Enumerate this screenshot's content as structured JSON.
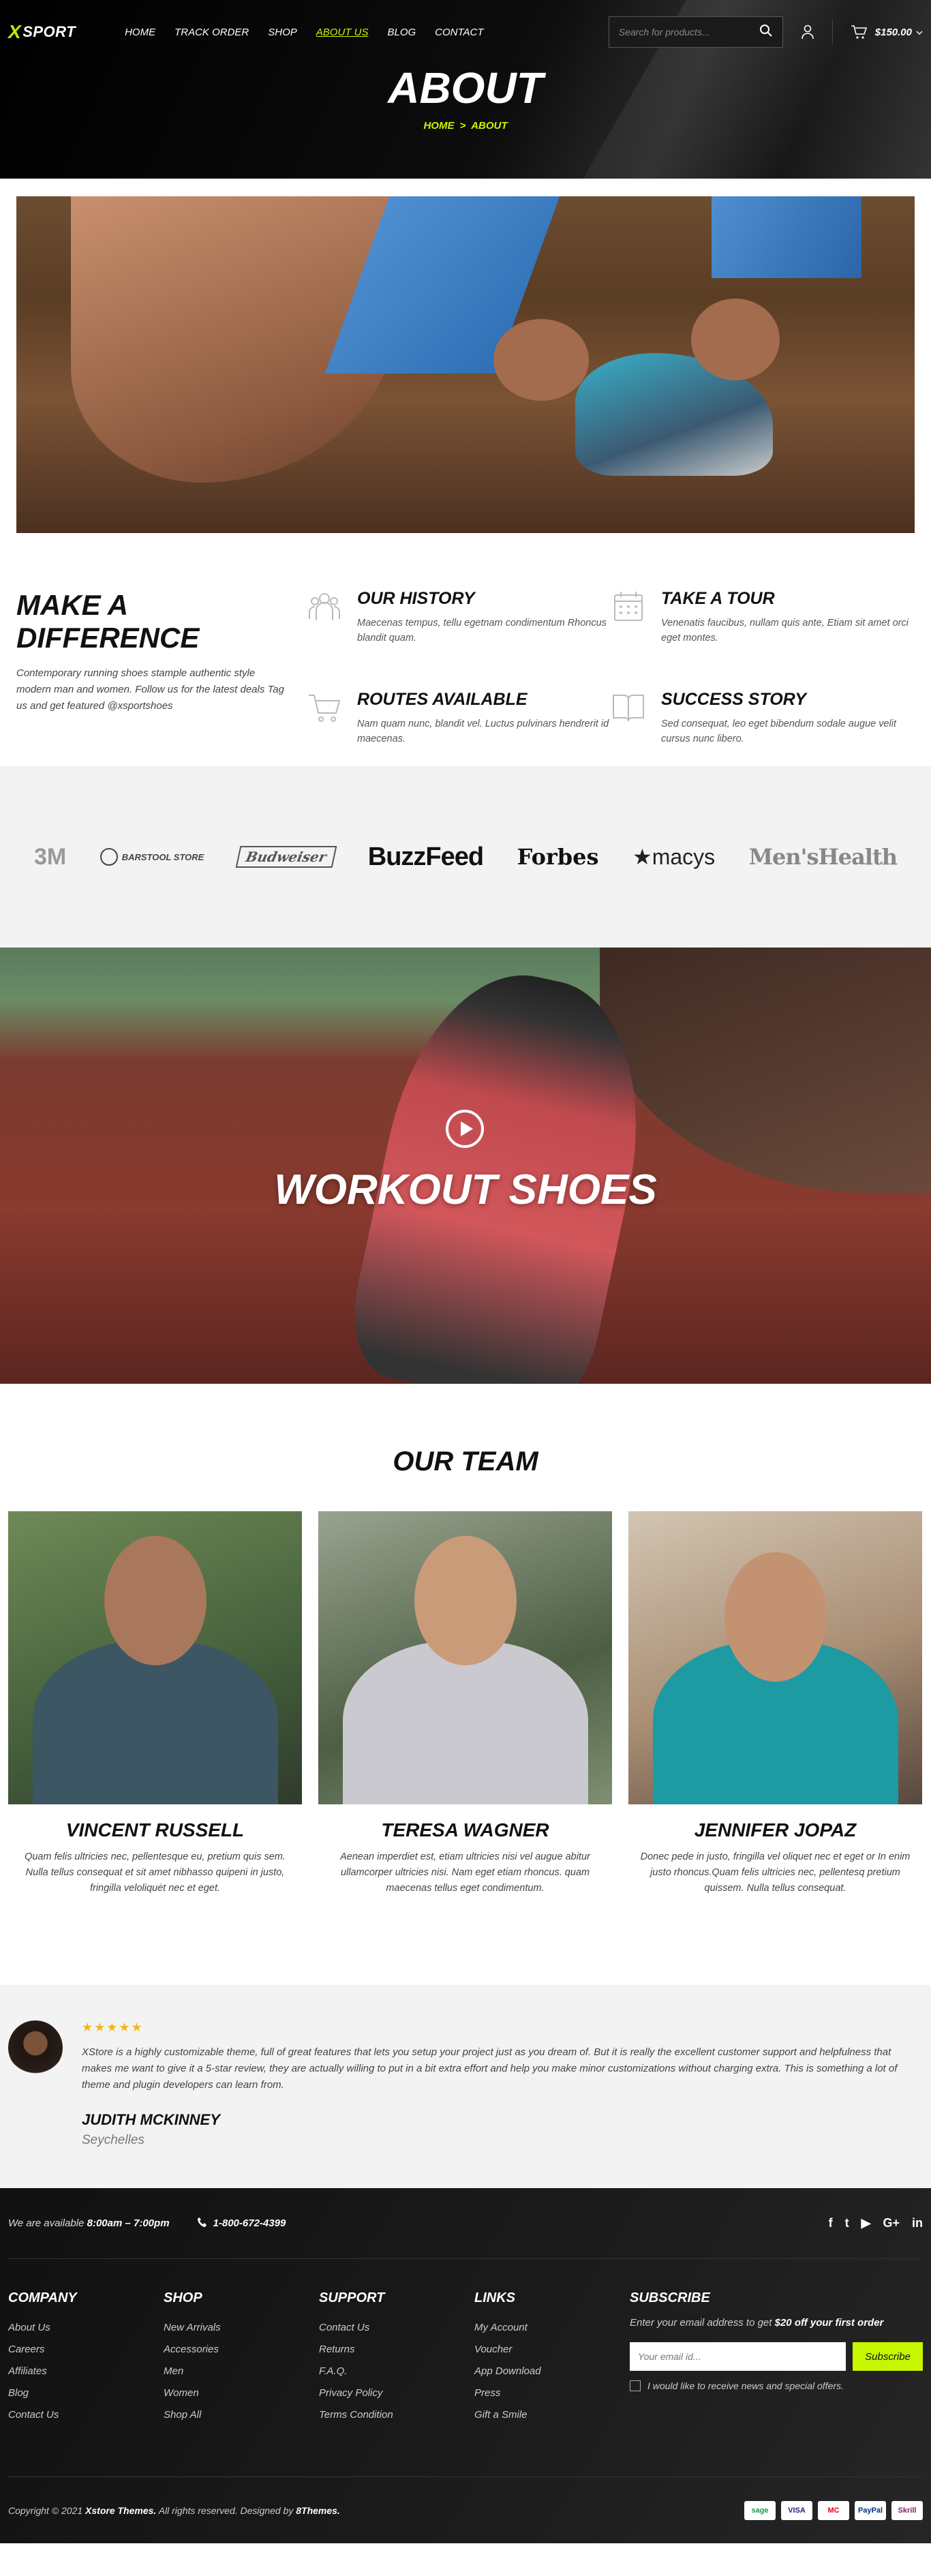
{
  "header": {
    "logo_text": "SPORT",
    "logo_mark": "X",
    "nav": [
      "HOME",
      "TRACK ORDER",
      "SHOP",
      "ABOUT US",
      "BLOG",
      "CONTACT"
    ],
    "search_placeholder": "Search for products...",
    "cart_total": "$150.00"
  },
  "hero": {
    "title": "ABOUT",
    "breadcrumb_home": "HOME",
    "breadcrumb_sep": ">",
    "breadcrumb_current": "ABOUT"
  },
  "intro": {
    "title": "MAKE A DIFFERENCE",
    "text": "Contemporary running shoes stample authentic style modern man and women. Follow us for the latest deals Tag us and get featured @xsportshoes"
  },
  "features": [
    {
      "title": "OUR HISTORY",
      "text": "Maecenas tempus, tellu egetnam condimentum Rhoncus blandit quam.",
      "icon": "people-icon"
    },
    {
      "title": "TAKE A TOUR",
      "text": "Venenatis faucibus, nullam quis ante, Etiam sit amet orci eget montes.",
      "icon": "calendar-icon"
    },
    {
      "title": "ROUTES AVAILABLE",
      "text": "Nam quam nunc, blandit vel. Luctus pulvinars hendrerit id maecenas.",
      "icon": "cart-icon"
    },
    {
      "title": "SUCCESS STORY",
      "text": "Sed consequat, leo eget bibendum sodale augue velit cursus nunc libero.",
      "icon": "book-icon"
    }
  ],
  "brands": [
    "3M",
    "BARSTOOL STORE",
    "Budweiser",
    "BuzzFeed",
    "Forbes",
    "★macys",
    "Men'sHealth"
  ],
  "video": {
    "title": "WORKOUT SHOES"
  },
  "team": {
    "title": "OUR TEAM",
    "members": [
      {
        "name": "VINCENT RUSSELL",
        "bio": "Quam felis ultricies nec, pellentesque eu, pretium quis sem. Nulla tellus consequat et sit amet nibhasso quipeni in justo, fringilla veloliquėt nec et eget."
      },
      {
        "name": "TERESA WAGNER",
        "bio": "Aenean imperdiet est, etiam ultricies nisi vel augue abitur ullamcorper ultricies nisi. Nam eget etiam rhoncus. quam maecenas tellus eget condimentum."
      },
      {
        "name": "JENNIFER JOPAZ",
        "bio": "Donec pede in justo, fringilla vel oliquet nec et eget or In enim justo rhoncus.Quam felis ultricies nec, pellentesq pretium quissem. Nulla tellus consequat."
      }
    ]
  },
  "testimonial": {
    "stars": "★★★★★",
    "text": "XStore is a highly customizable theme, full of great features that lets you setup your project just as you dream of. But it is really the excellent customer support and helpfulness that makes me want to give it a 5-star review, they are actually willing to put in a bit extra effort and help you make minor customizations without charging extra. This is something a lot of theme and plugin developers can learn from.",
    "name": "JUDITH MCKINNEY",
    "place": "Seychelles"
  },
  "footer": {
    "avail_prefix": "We are available",
    "avail_hours": "8:00am – 7:00pm",
    "phone": "1-800-672-4399",
    "social": [
      "f",
      "t",
      "▶",
      "G+",
      "in"
    ],
    "columns": [
      {
        "title": "COMPANY",
        "links": [
          "About Us",
          "Careers",
          "Affiliates",
          "Blog",
          "Contact Us"
        ]
      },
      {
        "title": "SHOP",
        "links": [
          "New Arrivals",
          "Accessories",
          "Men",
          "Women",
          "Shop All"
        ]
      },
      {
        "title": "SUPPORT",
        "links": [
          "Contact Us",
          "Returns",
          "F.A.Q.",
          "Privacy Policy",
          "Terms Condition"
        ]
      },
      {
        "title": "LINKS",
        "links": [
          "My Account",
          "Voucher",
          "App Download",
          "Press",
          "Gift a Smile"
        ]
      }
    ],
    "subscribe": {
      "title": "SUBSCRIBE",
      "text_prefix": "Enter your email address to get",
      "text_bold": "$20 off your first order",
      "placeholder": "Your email id...",
      "button": "Subscribe",
      "checkbox_label": "I would like to receive news and special offers."
    },
    "copyright_prefix": "Copyright © 2021",
    "copyright_brand": "Xstore Themes.",
    "copyright_middle": "All rights reserved. Designed by",
    "copyright_designer": "8Themes.",
    "payments": [
      "sage",
      "VISA",
      "MC",
      "PayPal",
      "Skrill"
    ]
  }
}
